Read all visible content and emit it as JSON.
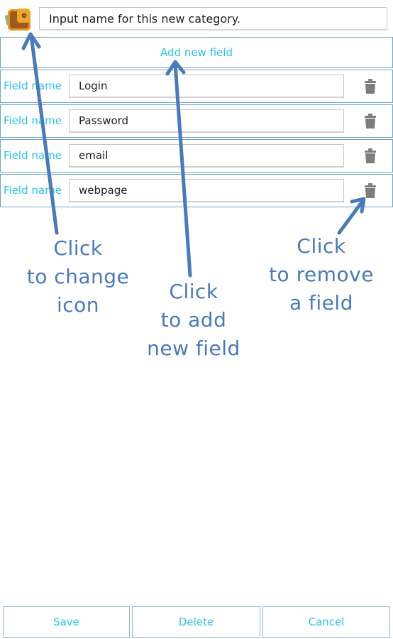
{
  "header": {
    "category_icon": "wallet-icon",
    "name_placeholder": "Input name for this new category.",
    "name_value": ""
  },
  "add_field_label": "Add new field",
  "fields": [
    {
      "label": "Field name",
      "value": "Login",
      "delete_icon": "trash-icon"
    },
    {
      "label": "Field name",
      "value": "Password",
      "delete_icon": "trash-icon"
    },
    {
      "label": "Field name",
      "value": "email",
      "delete_icon": "trash-icon"
    },
    {
      "label": "Field name",
      "value": "webpage",
      "delete_icon": "trash-icon"
    }
  ],
  "annotations": {
    "change_icon": [
      "Click",
      "to change",
      "icon"
    ],
    "add_field": [
      "Click",
      "to add",
      "new field"
    ],
    "remove_field": [
      "Click",
      "to remove",
      "a field"
    ]
  },
  "buttons": {
    "save": "Save",
    "delete": "Delete",
    "cancel": "Cancel"
  },
  "colors": {
    "accent_text": "#2bc3e8",
    "border": "#6fa6c6",
    "annotation": "#4a7ab8",
    "trash": "#7d7d7d"
  }
}
